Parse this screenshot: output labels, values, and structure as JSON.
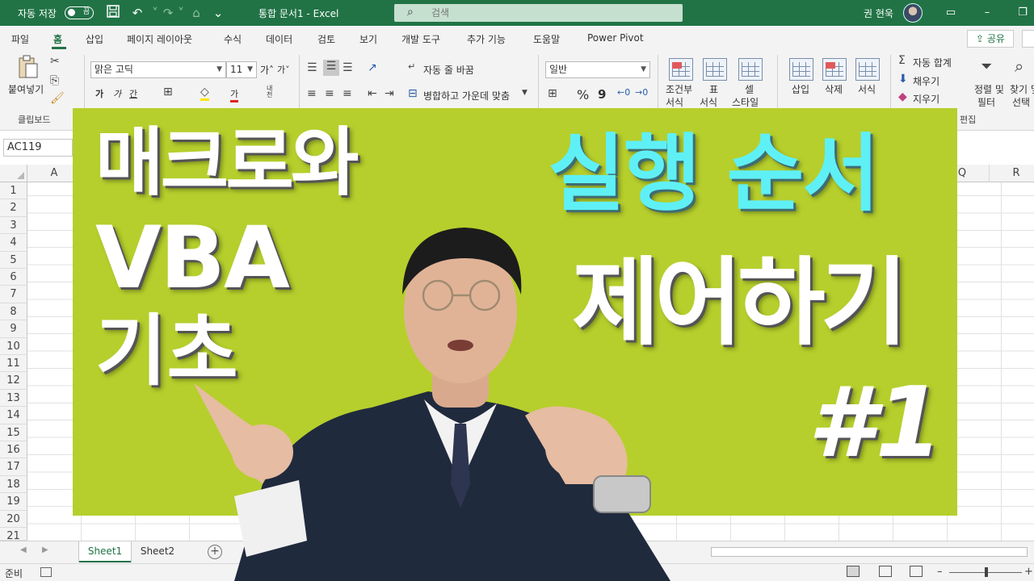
{
  "window": {
    "autosave_label": "자동 저장",
    "autosave_state": "끔",
    "doc_title": "통합 문서1  -  Excel",
    "search_placeholder": "검색",
    "username": "권 현욱"
  },
  "ribbon_tabs": [
    "파일",
    "홈",
    "삽입",
    "페이지 레이아웃",
    "수식",
    "데이터",
    "검토",
    "보기",
    "개발 도구",
    "추가 기능",
    "도움말",
    "Power Pivot"
  ],
  "share_label": "공유",
  "ribbon": {
    "paste_label": "붙여넣기",
    "clipboard_group": "클립보드",
    "font_name": "맑은 고딕",
    "font_size": "11",
    "grow_font": "가˄",
    "shrink_font": "가˅",
    "bold": "가",
    "italic": "가",
    "underline": "간",
    "font_color_glyph": "가",
    "phonetic": "내천",
    "wrap_text": "자동 줄 바꿈",
    "merge_center": "병합하고 가운데 맞춤",
    "number_format": "일반",
    "percent": "%",
    "comma": "9",
    "conditional_format": [
      "조건부",
      "서식"
    ],
    "format_table": [
      "표",
      "서식"
    ],
    "cell_styles": [
      "셀",
      "스타일"
    ],
    "insert": "삽입",
    "delete": "삭제",
    "format": "서식",
    "autosum": "자동 합계",
    "fill": "채우기",
    "clear": "지우기",
    "sort_filter": [
      "정렬 및",
      "필터"
    ],
    "find_select": [
      "찾기 및",
      "선택"
    ],
    "editing_group": "편집"
  },
  "name_box": "AC119",
  "columns": [
    "A",
    "Q",
    "R"
  ],
  "rows": [
    "1",
    "2",
    "3",
    "4",
    "5",
    "6",
    "7",
    "8",
    "9",
    "10",
    "11",
    "12",
    "13",
    "14",
    "15",
    "16",
    "17",
    "18",
    "19",
    "20",
    "21"
  ],
  "sheets": [
    "Sheet1",
    "Sheet2"
  ],
  "active_sheet": "Sheet1",
  "status": "준비",
  "thumbnail": {
    "left_title": [
      "매크로와",
      "VBA",
      "기초"
    ],
    "right_title": [
      "실행 순서",
      "제어하기",
      "#1"
    ],
    "banner_color": "#b6cf2c",
    "cyan_color": "#5ff0f6"
  }
}
